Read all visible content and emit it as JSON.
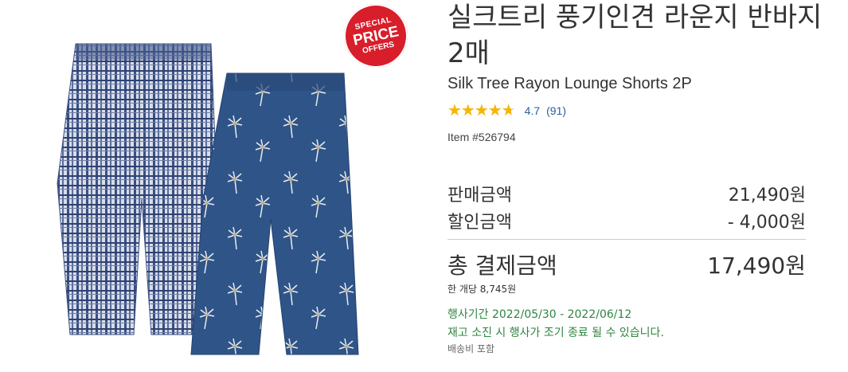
{
  "badge": {
    "line1": "SPECIAL",
    "line2": "PRICE",
    "line3": "OFFERS"
  },
  "product": {
    "title_ko": "실크트리 풍기인견 라운지 반바지 2매",
    "title_en": "Silk Tree Rayon Lounge Shorts 2P",
    "rating": {
      "value": "4.7",
      "value_num": 4.7,
      "max": 5,
      "count": "(91)",
      "stars": "★★★★★"
    },
    "item_number": "Item #526794"
  },
  "pricing": {
    "sale_label": "판매금액",
    "sale_value": "21,490원",
    "discount_label": "할인금액",
    "discount_value": "- 4,000원",
    "total_label": "총 결제금액",
    "total_value": "17,490원",
    "unit_price": "한 개당 8,745원"
  },
  "promo": {
    "period": "행사기간 2022/05/30 - 2022/06/12",
    "notice": "재고 소진 시 행사가 조기 종료 될 수 있습니다.",
    "shipping": "배송비 포함"
  },
  "colors": {
    "star": "#f7b500",
    "link": "#2b5e9c",
    "promo_green": "#2e8540",
    "badge_red": "#d81e2b"
  }
}
